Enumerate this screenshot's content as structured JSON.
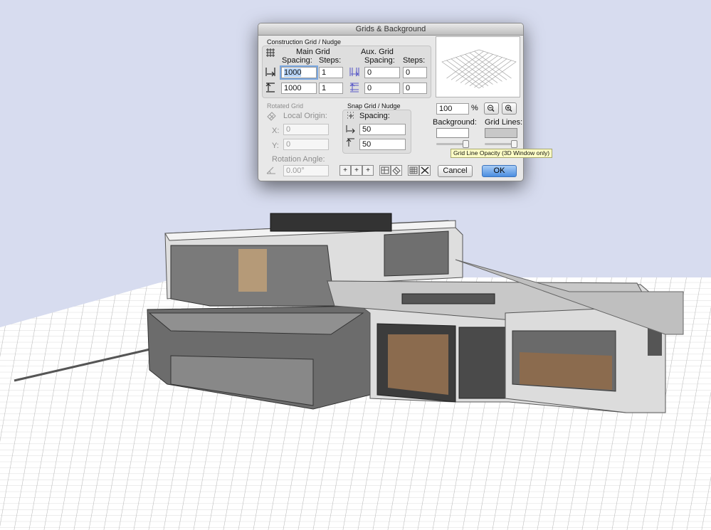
{
  "dialog": {
    "title": "Grids & Background",
    "construction": {
      "group_title": "Construction Grid / Nudge",
      "main_grid_title": "Main Grid",
      "aux_grid_title": "Aux. Grid",
      "spacing_label": "Spacing:",
      "steps_label": "Steps:",
      "main_h_spacing": "1000",
      "main_h_steps": "1",
      "main_v_spacing": "1000",
      "main_v_steps": "1",
      "aux_h_spacing": "0",
      "aux_h_steps": "0",
      "aux_v_spacing": "0",
      "aux_v_steps": "0"
    },
    "rotated": {
      "group_title": "Rotated Grid",
      "origin_label": "Local Origin:",
      "x_label": "X:",
      "x_value": "0",
      "y_label": "Y:",
      "y_value": "0",
      "angle_label": "Rotation Angle:",
      "angle_value": "0.00°"
    },
    "snap": {
      "group_title": "Snap Grid / Nudge",
      "spacing_label": "Spacing:",
      "h_value": "50",
      "v_value": "50"
    },
    "zoom": {
      "value": "100",
      "unit": "%"
    },
    "background_label": "Background:",
    "grid_lines_label": "Grid Lines:",
    "tooltip": "Grid Line Opacity (3D Window only)",
    "cancel_label": "Cancel",
    "ok_label": "OK",
    "colors": {
      "background_swatch": "#ffffff",
      "grid_lines_swatch": "#c8c8c8",
      "ok_button": "#4b8ee0"
    }
  },
  "scene": {
    "sky_color": "#d7dcef",
    "ground_color": "#ffffff",
    "grid_line_color": "#b4b4b4"
  }
}
